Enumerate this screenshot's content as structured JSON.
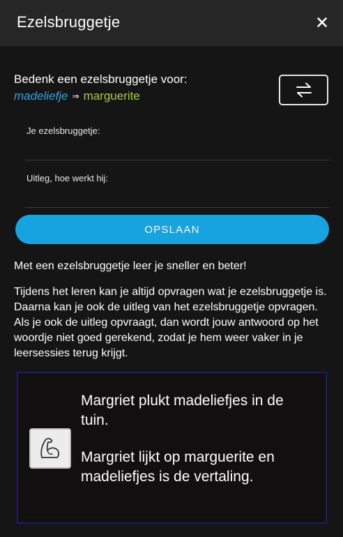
{
  "header": {
    "title": "Ezelsbruggetje",
    "close_icon": "close-icon"
  },
  "prompt": {
    "text": "Bedenk een ezelsbruggetje voor:",
    "source_word": "madeliefje",
    "arrow": "⇒",
    "target_word": "marguerite",
    "swap_icon": "swap-arrows-icon"
  },
  "form": {
    "mnemonic_label": "Je ezelsbruggetje:",
    "mnemonic_value": "",
    "explanation_label": "Uitleg, hoe werkt hij:",
    "explanation_value": "",
    "save_label": "OPSLAAN"
  },
  "info": {
    "intro": "Met een ezelsbruggetje leer je sneller en beter!",
    "details": "Tijdens het leren kan je altijd opvragen wat je ezelsbruggetje is. Daarna kan je ook de uitleg van het ezelsbruggetje opvragen. Als je ook de uitleg opvraagt, dan wordt jouw antwoord op het woordje niet goed gerekend, zodat je hem weer vaker in je leersessies terug krijgt."
  },
  "example": {
    "icon": "flexed-bicep-icon",
    "mnemonic": "Margriet plukt madeliefjes in de tuin.",
    "explanation": "Margriet lijkt op marguerite en madeliefjes is de vertaling."
  },
  "colors": {
    "accent": "#16a3e0",
    "source_word": "#2fa4dd",
    "target_word": "#a8c94a",
    "header_bg": "#262626",
    "page_bg": "#151515",
    "card_border": "#1d1f6b"
  }
}
